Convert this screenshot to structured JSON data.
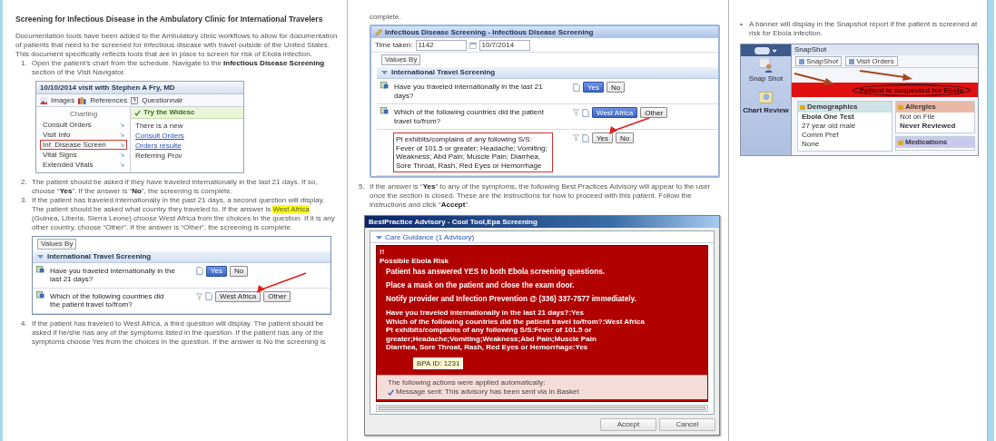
{
  "pages": [
    {
      "blocks": [
        {
          "kind": "heading",
          "text": "Screening for Infectious Disease in the Ambulatory Clinic for International Travelers"
        },
        {
          "kind": "paragraph",
          "text": "Documentation tools have been added to the Ambulatory clinic workflows to allow for documentation of patients that need to be screened for infectious disease with travel outside of the United States."
        },
        {
          "kind": "paragraph",
          "text": "This document specifically reflects tools that are in place to screen for risk of Ebola infection."
        },
        {
          "kind": "numbered",
          "marker": "1.",
          "segments": [
            {
              "text": "Open the patient’s chart from the schedule.  Navigate to the **Infectious Disease Screening** section of the Visit Navigator.",
              "highlighted": false
            }
          ]
        },
        {
          "kind": "visit_navigator",
          "title": "10/10/2014 visit with Stephen A Fry, MD",
          "toolbar": [
            "Images",
            "References",
            "Questionnair"
          ],
          "nav_heading": "Charting",
          "nav_items": [
            {
              "label": "Consult Orders",
              "selected": false
            },
            {
              "label": "Visit Info",
              "selected": false
            },
            {
              "label": "Inf. Disease Screen",
              "selected": true
            },
            {
              "label": "Vital Signs",
              "selected": false
            },
            {
              "label": "Extended Vitals",
              "selected": false
            }
          ],
          "notice": "Try the Widesc",
          "content": [
            {
              "text": "There is a new",
              "link": false
            },
            {
              "text": "Consult Orders",
              "link": true
            },
            {
              "text": "Orders resulte",
              "link": true
            },
            {
              "text": "Referring Prov",
              "link": false
            }
          ]
        },
        {
          "kind": "numbered",
          "marker": "2.",
          "segments": [
            {
              "text": "The patient should be asked if they have traveled internationally in the last 21 days.  If so, choose “**Yes**”.  If the answer is “**No**”, the screening is complete.",
              "highlighted": false
            }
          ]
        },
        {
          "kind": "numbered",
          "marker": "3.",
          "segments": [
            {
              "text": "If the patient has traveled internationally in the past 21 days, a second question will display.  The patient should be asked what country they traveled to.  If the answer is ",
              "highlighted": false
            },
            {
              "text": "West Africa",
              "highlighted": true
            },
            {
              "text": " (Guinea, Liberia, Sierra Leone) choose West Africa from the choices in the question.  If it is any other country, choose “Other”.   If the answer is “Other”, the screening is complete.",
              "highlighted": false
            }
          ]
        },
        {
          "kind": "travel_form",
          "values_by": "Values By",
          "section": "International Travel Screening",
          "questions": [
            {
              "text": "Have you traveled internationally in the last 21 days?",
              "highlighted": false,
              "options": [
                {
                  "label": "Yes",
                  "selected": true,
                  "arrow": false
                },
                {
                  "label": "No",
                  "selected": false,
                  "arrow": false
                }
              ]
            },
            {
              "text": "Which of the following countries did the patient travel to/from?",
              "highlighted": false,
              "options": [
                {
                  "label": "West Africa",
                  "selected": false,
                  "arrow": true
                },
                {
                  "label": "Other",
                  "selected": false,
                  "arrow": false
                }
              ]
            }
          ]
        },
        {
          "kind": "numbered",
          "marker": "4.",
          "segments": [
            {
              "text": "If the patient has traveled to West Africa, a third question will display.  The patient should be asked if he/she has any of the symptoms listed in the question.  If the patient has any of the symptoms choose Yes from the choices in the question.  If the answer is No the screening is",
              "highlighted": false
            }
          ]
        }
      ]
    },
    {
      "blocks": [
        {
          "kind": "continuation",
          "text": "complete."
        },
        {
          "kind": "screening_form",
          "title": "Infectious Disease Screening - Infectious Disease Screening",
          "time_label": "Time taken:",
          "time": "1142",
          "date": "10/7/2014",
          "values_by": "Values By",
          "section": "International Travel Screening",
          "questions": [
            {
              "text": "Have you traveled internationally in the last 21 days?",
              "highlighted": false,
              "options": [
                {
                  "label": "Yes",
                  "selected": true,
                  "arrow": false
                },
                {
                  "label": "No",
                  "selected": false,
                  "arrow": false
                }
              ]
            },
            {
              "text": "Which of the following countries did the patient travel to/from?",
              "highlighted": false,
              "options": [
                {
                  "label": "West Africa",
                  "selected": true,
                  "arrow": false
                },
                {
                  "label": "Other",
                  "selected": false,
                  "arrow": false
                }
              ]
            },
            {
              "text": "Pt exhibits/complains of any following S/S: Fever of 101.5 or greater; Headache; Vomiting; Weakness; Abd Pain; Muscle Pain; Diarrhea, Sore Throat, Rash, Red Eyes or Hemorrhage",
              "highlighted": true,
              "options": [
                {
                  "label": "Yes",
                  "selected": false,
                  "arrow": true
                },
                {
                  "label": "No",
                  "selected": false,
                  "arrow": false
                }
              ]
            }
          ]
        },
        {
          "kind": "numbered",
          "marker": "5.",
          "segments": [
            {
              "text": "If the answer is “**Yes**” to any of the symptoms, the following Best Practices Advisory will appear to the user once the section is closed.  These are the instructions for how to proceed with this patient.  Follow the instructions and click “**Accept**”.",
              "highlighted": false
            }
          ]
        },
        {
          "kind": "advisory",
          "title": "BestPractice Advisory - Cool Tool,Epa Screening",
          "guidance": "Care Guidance (1 Advisory)",
          "alert_mark": "!!",
          "alert_title": "Possible Ebola Risk",
          "messages": [
            "Patient has answered YES to both Ebola screening questions.",
            "Place a mask on the patient and close the exam door.",
            "Notify provider and Infection Prevention @ (336) 337-7577 immediately."
          ],
          "details": [
            "Have you traveled internationally in the last 21 days?:Yes",
            "Which of the following countries did the patient travel to/from?:West Africa",
            "Pt exhibits/complains of any following S/S:Fever of 101.5 or greater;Headache;Vomiting;Weakness;Abd Pain;Muscle Pain",
            "Diarrhea, Sore Throat, Rash, Red Eyes or Hemorrhage:Yes"
          ],
          "bpa_id": "BPA ID: 1231",
          "actions_title": "The following actions were applied automatically:",
          "action": "Message sent: This advisory has been sent via In Basket",
          "buttons": [
            "Accept",
            "Cancel"
          ]
        }
      ]
    },
    {
      "blocks": [
        {
          "kind": "bullet",
          "marker": "•",
          "segments": [
            {
              "text": "A banner will display in the Snapshot report if the patient is screened at risk for Ebola infection.",
              "highlighted": false
            }
          ]
        },
        {
          "kind": "snapshot",
          "sidebar": [
            "Snap Shot",
            "Chart Review"
          ],
          "title": "SnapShot",
          "tabs": [
            "SnapShot",
            "Visit Orders"
          ],
          "banner": "Patient is suspected for Ebola",
          "panels": [
            {
              "kind": "demographics",
              "title": "Demographics",
              "lines": [
                "Ebola One Test",
                "27 year old male",
                "Comm Pref",
                "None"
              ]
            },
            {
              "kind": "allergies",
              "title": "Allergies",
              "lines": [
                "Not on File",
                "Never Reviewed"
              ]
            },
            {
              "kind": "medications",
              "title": "Medications"
            }
          ]
        }
      ]
    }
  ]
}
